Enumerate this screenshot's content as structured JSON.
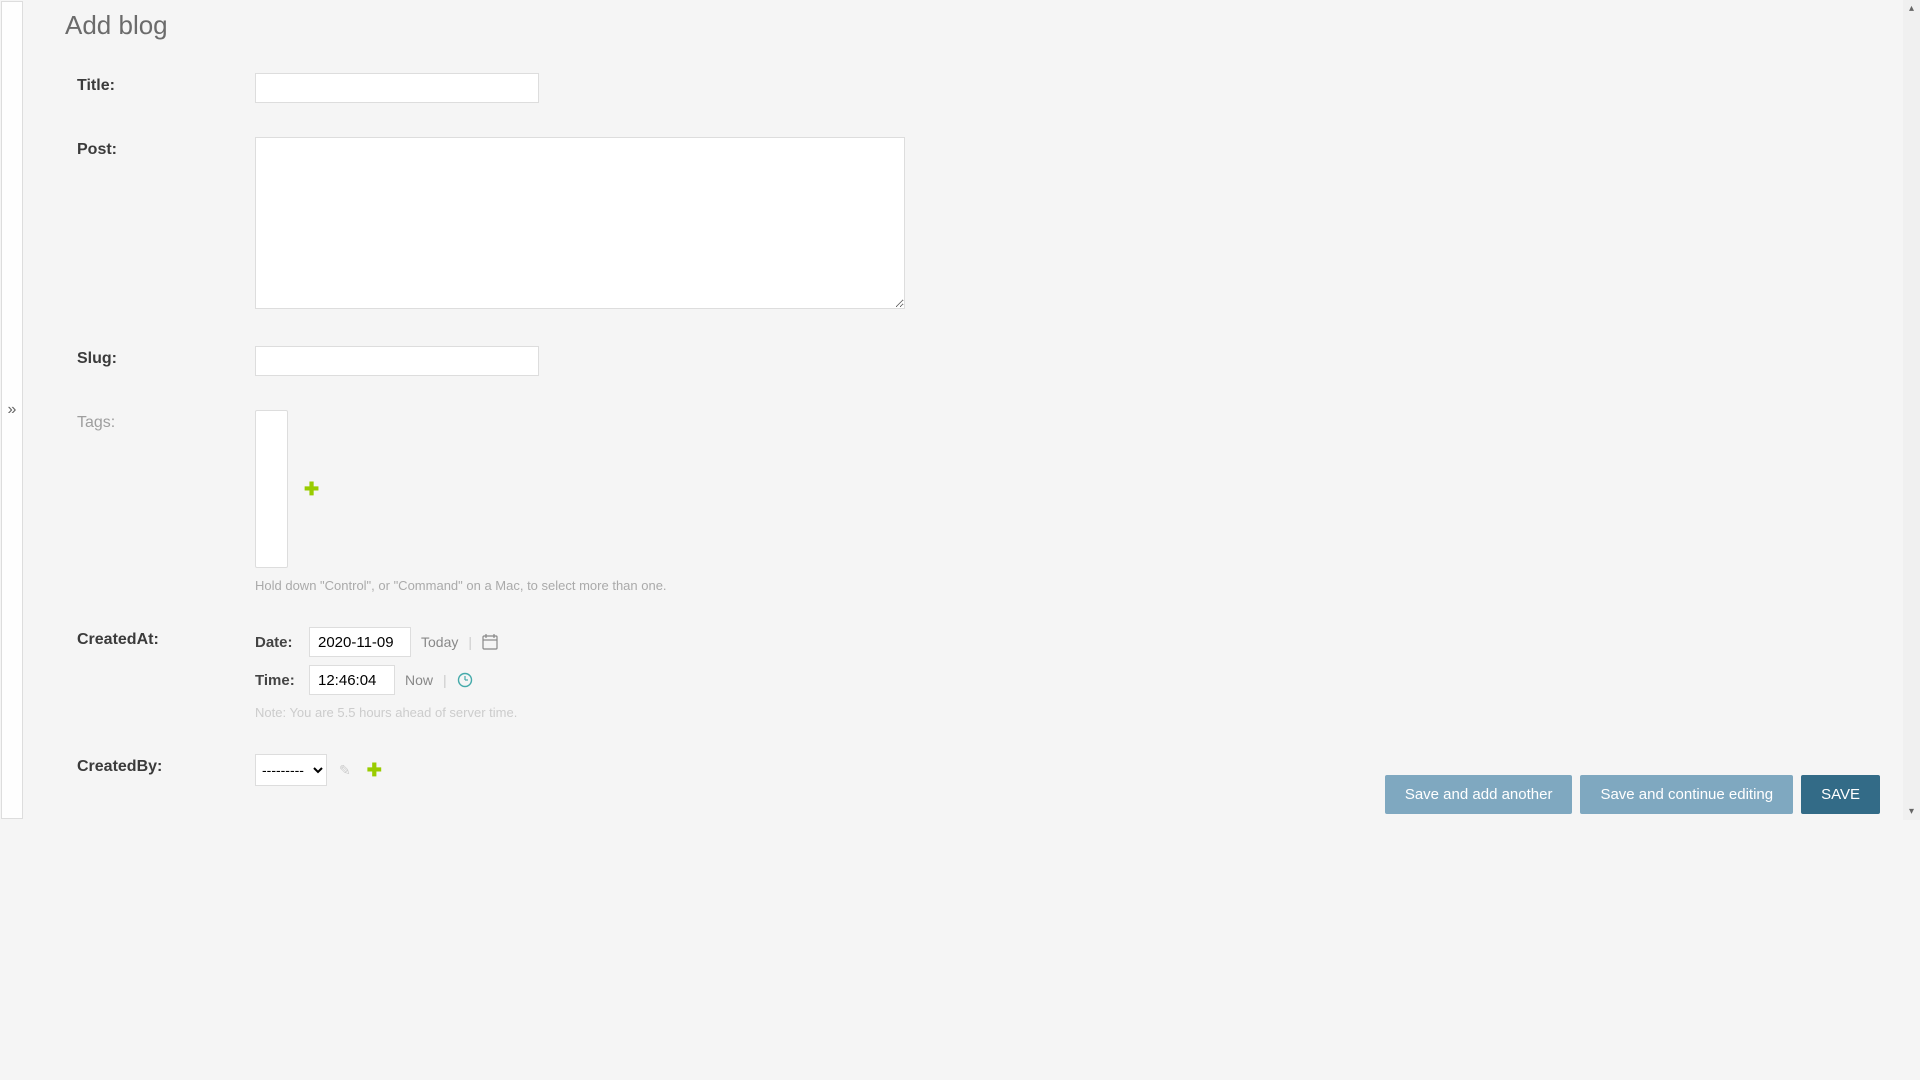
{
  "page": {
    "title": "Add blog"
  },
  "sidebar": {
    "toggle_glyph": "»"
  },
  "fields": {
    "title": {
      "label": "Title:",
      "value": ""
    },
    "post": {
      "label": "Post:",
      "value": ""
    },
    "slug": {
      "label": "Slug:",
      "value": ""
    },
    "tags": {
      "label": "Tags:",
      "help": "Hold down \"Control\", or \"Command\" on a Mac, to select more than one."
    },
    "created_at": {
      "label": "CreatedAt:",
      "date_label": "Date:",
      "date_value": "2020-11-09",
      "today_link": "Today",
      "time_label": "Time:",
      "time_value": "12:46:04",
      "now_link": "Now",
      "note": "Note: You are 5.5 hours ahead of server time."
    },
    "created_by": {
      "label": "CreatedBy:",
      "selected": "---------"
    }
  },
  "buttons": {
    "save_add_another": "Save and add another",
    "save_continue": "Save and continue editing",
    "save": "SAVE"
  }
}
